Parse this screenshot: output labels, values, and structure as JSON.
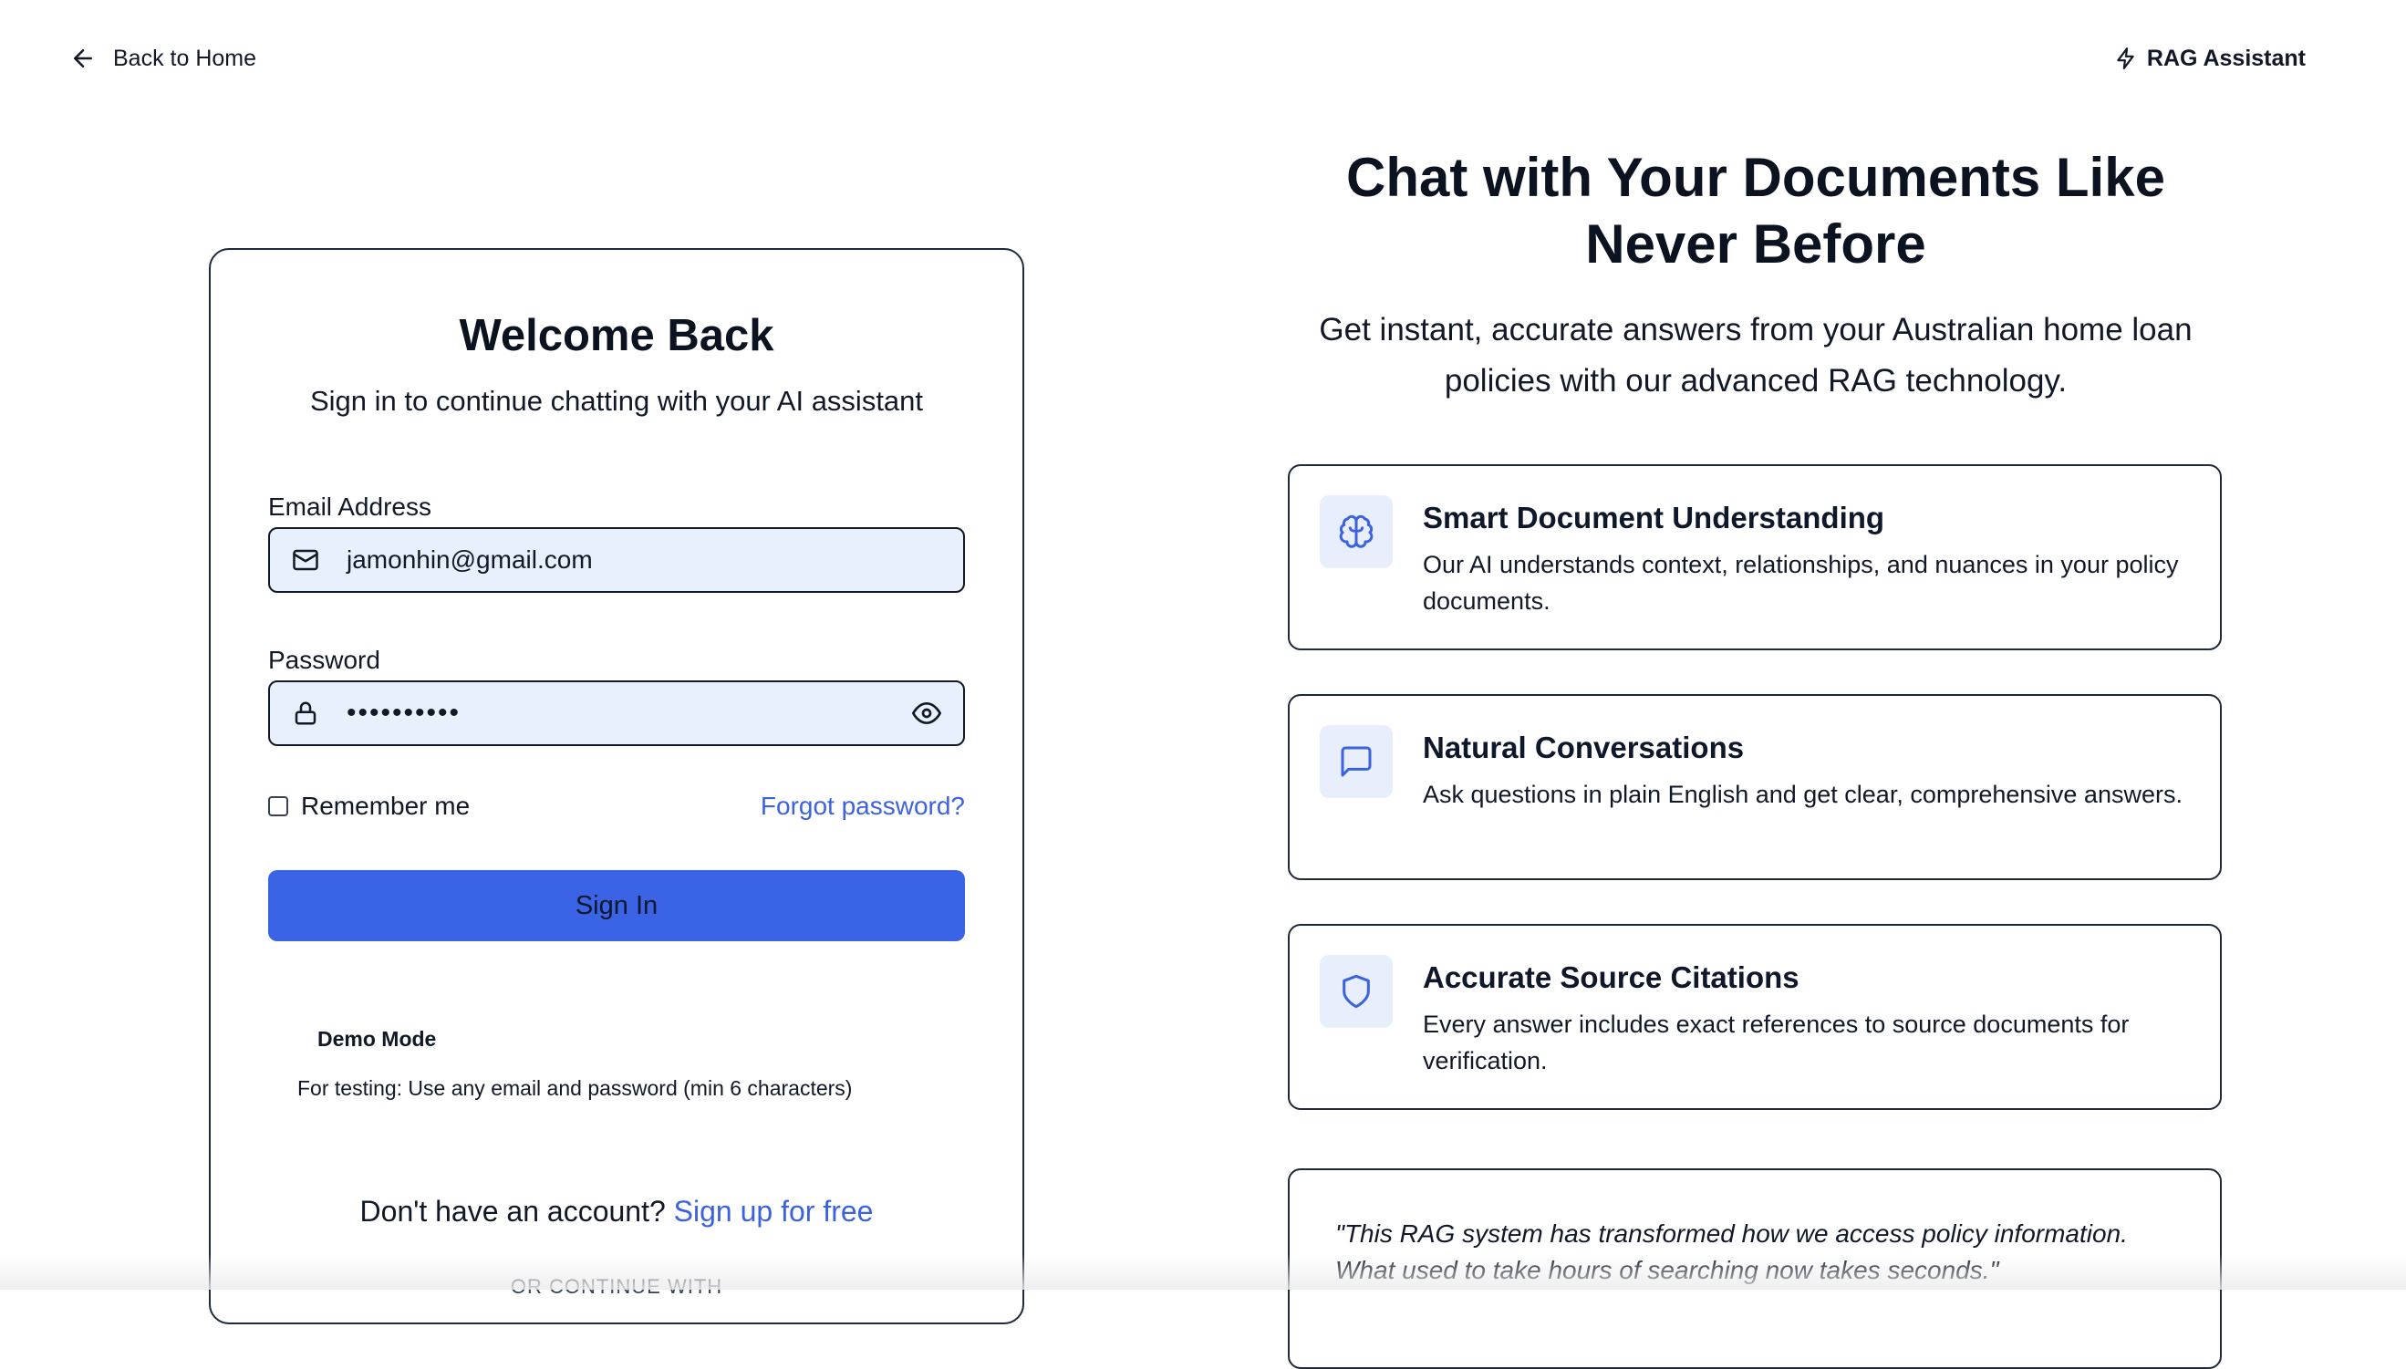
{
  "nav": {
    "back_label": "Back to Home",
    "brand_label": "RAG Assistant",
    "back_icon": "arrow-left-icon",
    "brand_icon": "zap-icon"
  },
  "login": {
    "title": "Welcome Back",
    "subtitle": "Sign in to continue chatting with your AI assistant",
    "email_label": "Email Address",
    "email_value": "jamonhin@gmail.com",
    "password_label": "Password",
    "password_value": "••••••••••",
    "remember_label": "Remember me",
    "remember_checked": false,
    "forgot_label": "Forgot password?",
    "signin_label": "Sign In",
    "demo_title": "Demo Mode",
    "demo_text": "For testing: Use any email and password (min 6 characters)",
    "signup_prompt": "Don't have an account?",
    "signup_link": "Sign up for free",
    "or_continue": "OR CONTINUE WITH"
  },
  "hero": {
    "title": "Chat with Your Documents Like Never Before",
    "subtitle": "Get instant, accurate answers from your Australian home loan policies with our advanced RAG technology."
  },
  "features": [
    {
      "icon": "brain-icon",
      "title": "Smart Document Understanding",
      "description": "Our AI understands context, relationships, and nuances in your policy documents."
    },
    {
      "icon": "message-square-icon",
      "title": "Natural Conversations",
      "description": "Ask questions in plain English and get clear, comprehensive answers."
    },
    {
      "icon": "shield-icon",
      "title": "Accurate Source Citations",
      "description": "Every answer includes exact references to source documents for verification."
    }
  ],
  "testimonial": {
    "quote": "\"This RAG system has transformed how we access policy information. What used to take hours of searching now takes seconds.\""
  },
  "colors": {
    "accent": "#3b63e6",
    "link": "#3b62e0",
    "input_bg": "#e8effd",
    "icon_bg": "#e8eefc",
    "icon_stroke": "#3b62e0"
  }
}
